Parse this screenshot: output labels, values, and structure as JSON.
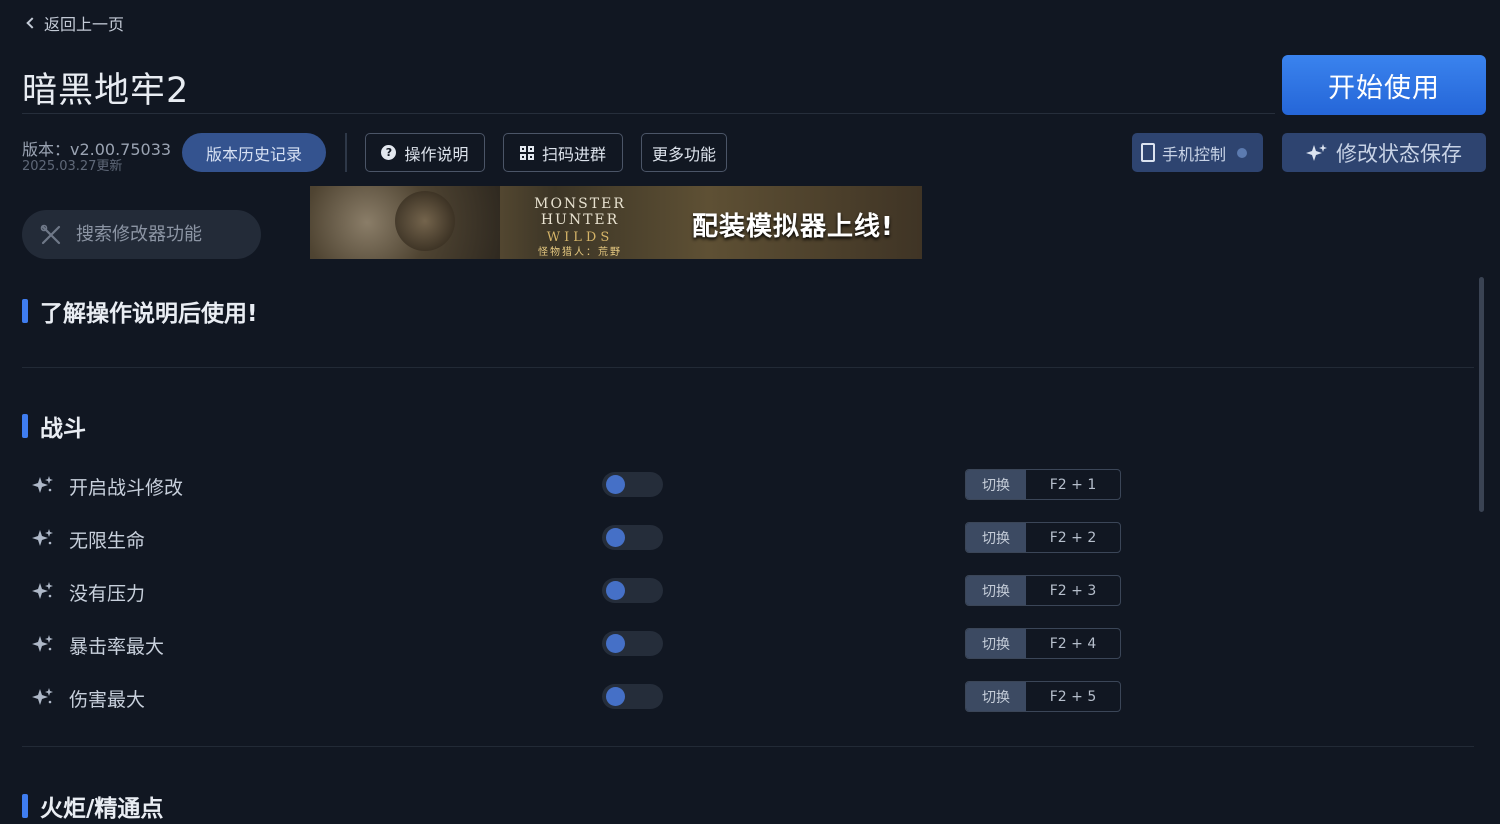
{
  "header": {
    "back_label": "返回上一页",
    "title": "暗黑地牢2",
    "start_label": "开始使用"
  },
  "version": {
    "line": "版本：v2.00.75033",
    "date": "2025.03.27更新",
    "history_label": "版本历史记录"
  },
  "toolbar": {
    "help_label": "操作说明",
    "qr_label": "扫码进群",
    "more_label": "更多功能",
    "phone_label": "手机控制",
    "save_label": "修改状态保存"
  },
  "search": {
    "placeholder": "搜索修改器功能"
  },
  "banner": {
    "logo_line1": "MONSTER HUNTER",
    "logo_line2": "WILDS",
    "logo_line3": "怪物猎人：荒野",
    "headline": "配装模拟器上线!"
  },
  "sections": {
    "notice": "了解操作说明后使用!",
    "battle": "战斗",
    "torch": "火炬/精通点"
  },
  "battle_items": [
    {
      "label": "开启战斗修改",
      "switch_label": "切换",
      "hotkey": "F2 + 1",
      "enabled": false
    },
    {
      "label": "无限生命",
      "switch_label": "切换",
      "hotkey": "F2 + 2",
      "enabled": false
    },
    {
      "label": "没有压力",
      "switch_label": "切换",
      "hotkey": "F2 + 3",
      "enabled": false
    },
    {
      "label": "暴击率最大",
      "switch_label": "切换",
      "hotkey": "F2 + 4",
      "enabled": false
    },
    {
      "label": "伤害最大",
      "switch_label": "切换",
      "hotkey": "F2 + 5",
      "enabled": false
    }
  ],
  "colors": {
    "background": "#111722",
    "accent": "#3f7df0",
    "start_button": "#2f76e6",
    "secondary_button": "#2e4470"
  }
}
